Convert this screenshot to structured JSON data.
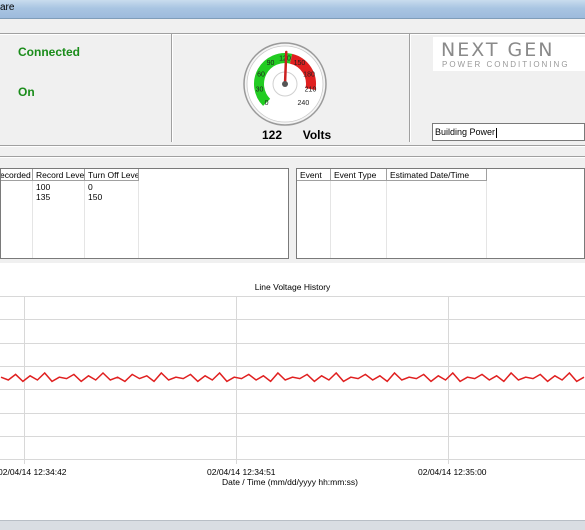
{
  "window": {
    "title_fragment": "are"
  },
  "status": {
    "connection": "Connected",
    "power": "On"
  },
  "gauge": {
    "value": 122,
    "min": 0,
    "max": 240,
    "tick_labels": [
      "0",
      "30",
      "60",
      "90",
      "120",
      "150",
      "180",
      "210",
      "240"
    ],
    "value_label": "122",
    "unit_label": "Volts",
    "colors": {
      "good": "#22cc22",
      "bad": "#e02020",
      "needle": "#cc2020"
    }
  },
  "logo": {
    "main": "NEXT GEN",
    "sub": "POWER CONDITIONING"
  },
  "location": {
    "value": "Building Power"
  },
  "levels_table": {
    "headers": [
      "ecorded",
      "Record Level",
      "Turn Off Level"
    ],
    "rows": [
      [
        "",
        "100",
        "0"
      ],
      [
        "",
        "135",
        "150"
      ]
    ]
  },
  "events_table": {
    "headers": [
      "Event",
      "Event Type",
      "Estimated Date/Time"
    ],
    "rows": []
  },
  "chart_data": {
    "type": "line",
    "title": "Line Voltage History",
    "xlabel": "Date / Time (mm/dd/yyyy hh:mm:ss)",
    "ylabel": "",
    "x_ticks": [
      "02/04/14 12:34:42",
      "02/04/14 12:34:51",
      "02/04/14 12:35:00"
    ],
    "grid": true,
    "series": [
      {
        "color": "#e02020",
        "values": [
          122,
          120,
          124,
          119,
          123,
          120,
          125,
          119,
          122,
          121,
          124,
          119,
          123,
          120,
          125,
          120,
          122,
          119,
          124,
          121,
          123,
          119,
          125,
          120,
          122,
          121,
          124,
          119,
          123,
          120,
          125,
          119,
          122,
          121,
          124,
          120,
          123,
          119,
          125,
          120,
          122,
          121,
          124,
          119,
          123,
          120,
          125,
          119,
          122,
          121,
          124,
          120,
          123,
          119,
          125,
          120,
          122,
          121,
          124,
          119,
          123,
          120,
          125,
          119,
          122,
          121,
          124,
          120,
          123,
          119,
          125,
          120,
          122,
          121,
          124,
          119,
          123,
          120,
          125,
          119,
          122
        ]
      }
    ]
  },
  "taskbar": {}
}
